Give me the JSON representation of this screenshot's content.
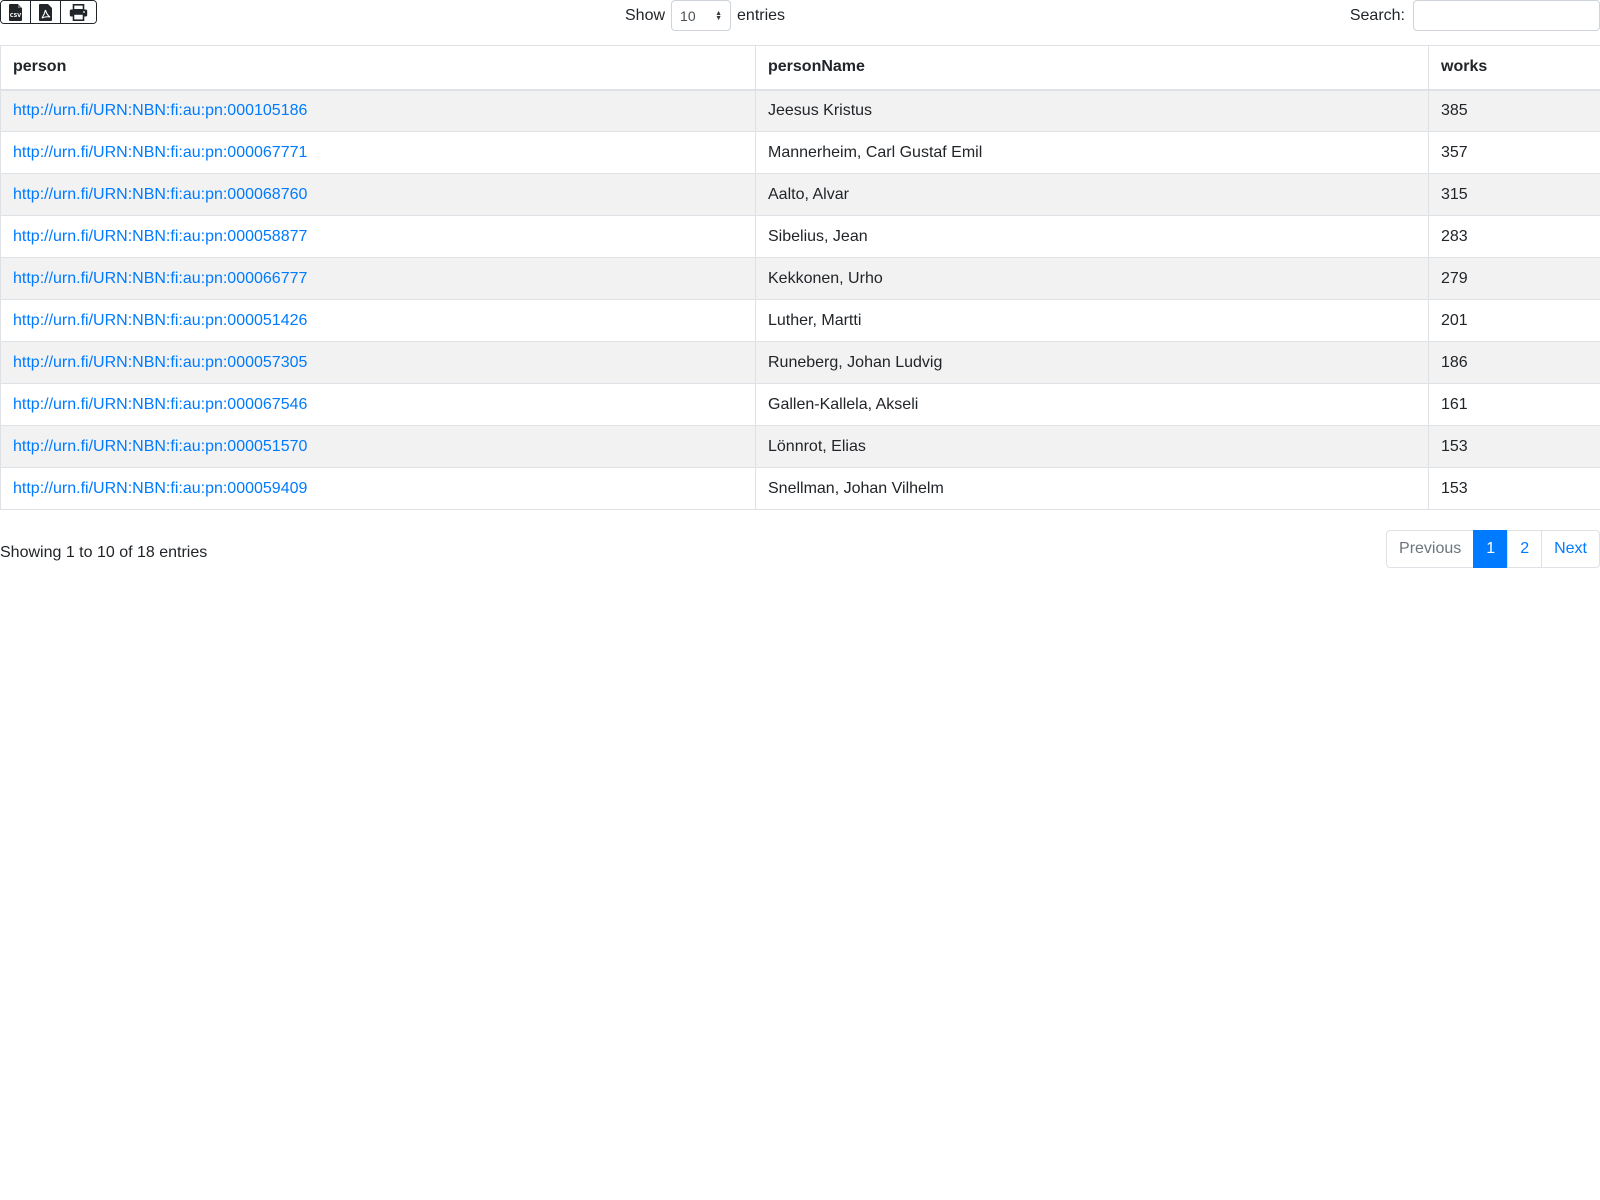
{
  "toolbar": {
    "export_buttons": [
      {
        "icon": "csv-file-icon",
        "text": "CSV"
      },
      {
        "icon": "pdf-file-icon"
      },
      {
        "icon": "print-icon"
      }
    ],
    "length": {
      "prefix": "Show",
      "value": "10",
      "suffix": "entries"
    },
    "search": {
      "label": "Search:",
      "value": ""
    }
  },
  "table": {
    "columns": [
      "person",
      "personName",
      "works"
    ],
    "rows": [
      {
        "person": "http://urn.fi/URN:NBN:fi:au:pn:000105186",
        "personName": "Jeesus Kristus",
        "works": "385"
      },
      {
        "person": "http://urn.fi/URN:NBN:fi:au:pn:000067771",
        "personName": "Mannerheim, Carl Gustaf Emil",
        "works": "357"
      },
      {
        "person": "http://urn.fi/URN:NBN:fi:au:pn:000068760",
        "personName": "Aalto, Alvar",
        "works": "315"
      },
      {
        "person": "http://urn.fi/URN:NBN:fi:au:pn:000058877",
        "personName": "Sibelius, Jean",
        "works": "283"
      },
      {
        "person": "http://urn.fi/URN:NBN:fi:au:pn:000066777",
        "personName": "Kekkonen, Urho",
        "works": "279"
      },
      {
        "person": "http://urn.fi/URN:NBN:fi:au:pn:000051426",
        "personName": "Luther, Martti",
        "works": "201"
      },
      {
        "person": "http://urn.fi/URN:NBN:fi:au:pn:000057305",
        "personName": "Runeberg, Johan Ludvig",
        "works": "186"
      },
      {
        "person": "http://urn.fi/URN:NBN:fi:au:pn:000067546",
        "personName": "Gallen-Kallela, Akseli",
        "works": "161"
      },
      {
        "person": "http://urn.fi/URN:NBN:fi:au:pn:000051570",
        "personName": "Lönnrot, Elias",
        "works": "153"
      },
      {
        "person": "http://urn.fi/URN:NBN:fi:au:pn:000059409",
        "personName": "Snellman, Johan Vilhelm",
        "works": "153"
      }
    ]
  },
  "footer": {
    "info": "Showing 1 to 10 of 18 entries",
    "pagination": {
      "previous": "Previous",
      "pages": [
        "1",
        "2"
      ],
      "active_page": "1",
      "next": "Next"
    }
  },
  "colors": {
    "link": "#007bff",
    "active_page_bg": "#007bff",
    "stripe": "#f2f2f2",
    "border": "#dee2e6",
    "text": "#212529"
  }
}
